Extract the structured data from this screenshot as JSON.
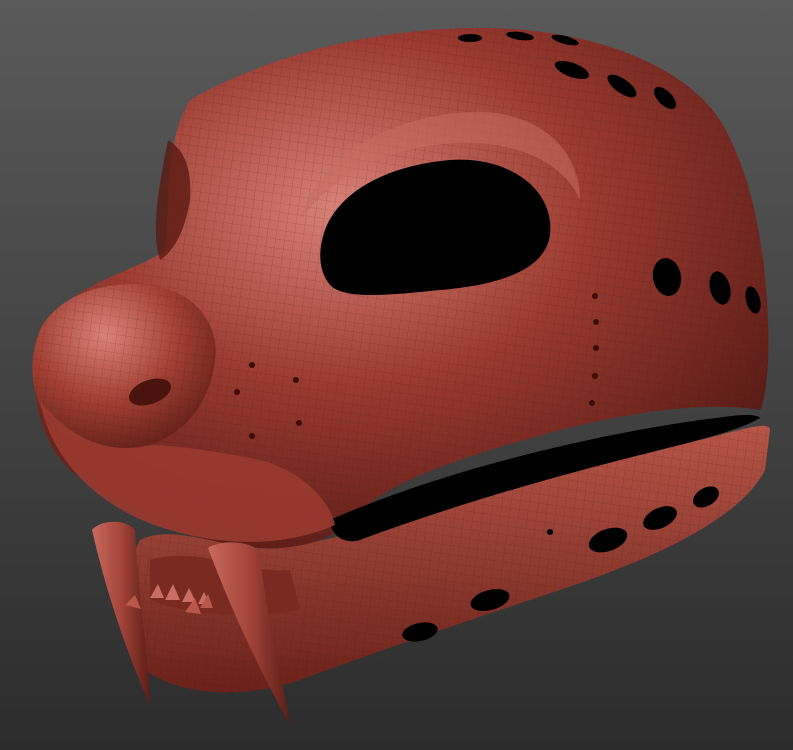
{
  "scene": {
    "subject_icon": "sabertooth-cat-mask-icon",
    "colors": {
      "background_top": "#5a5a5a",
      "background_bottom": "#2c2c2c",
      "material_base": "#9a3a30",
      "material_highlight": "#d98378",
      "material_shadow": "#4e1712",
      "opening": "#000000"
    }
  }
}
